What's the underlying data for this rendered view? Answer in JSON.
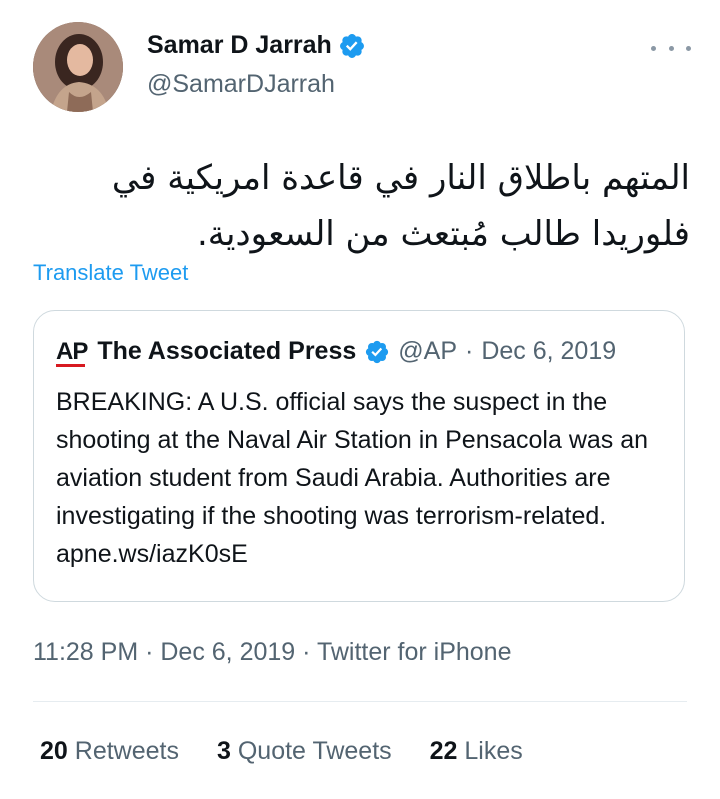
{
  "author": {
    "display_name": "Samar D Jarrah",
    "handle": "@SamarDJarrah",
    "verified_icon": "verified-badge-icon",
    "accent_color": "#1d9bf0"
  },
  "tweet": {
    "text": "المتهم باطلاق النار في قاعدة امريكية في فلوريدا طالب مُبتعث من السعودية.",
    "translate_label": "Translate Tweet"
  },
  "quoted_tweet": {
    "logo_text": "AP",
    "display_name": "The Associated Press",
    "handle": "@AP",
    "separator": "·",
    "date": "Dec 6, 2019",
    "text": "BREAKING: A U.S. official says the suspect in the shooting at the Naval Air Station in Pensacola was an aviation student from Saudi Arabia. Authorities are investigating if the shooting was terrorism-related. apne.ws/iazK0sE"
  },
  "meta": {
    "timestamp": "11:28 PM · Dec 6, 2019 · Twitter for iPhone"
  },
  "stats": {
    "retweets_count": "20",
    "retweets_label": "Retweets",
    "quotes_count": "3",
    "quotes_label": "Quote Tweets",
    "likes_count": "22",
    "likes_label": "Likes"
  }
}
